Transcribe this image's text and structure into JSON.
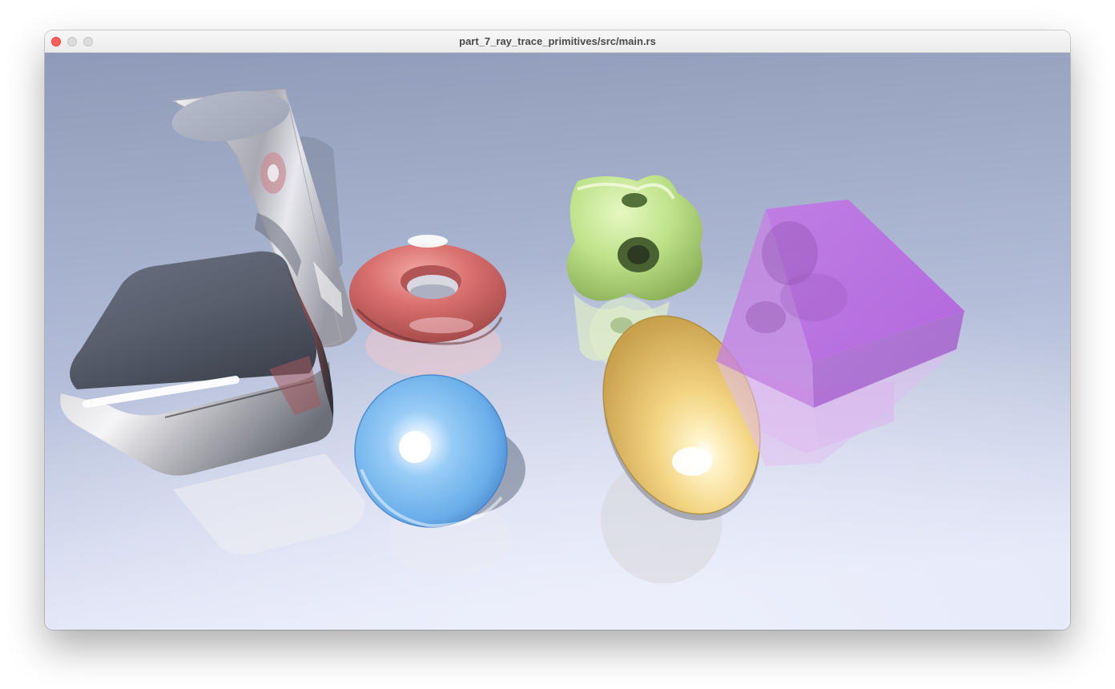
{
  "window": {
    "title": "part_7_ray_trace_primitives/src/main.rs",
    "controls": {
      "close": "close-button",
      "minimize": "minimize-button",
      "zoom": "zoom-button"
    }
  },
  "scene": {
    "background": {
      "top": "#8f9bb8",
      "bottom": "#e6eaf8"
    },
    "objects": [
      {
        "name": "mirror-cylinder",
        "material": "chrome",
        "color": "#c9c9cf"
      },
      {
        "name": "rounded-cube",
        "material": "chrome",
        "color": "#8a8f99"
      },
      {
        "name": "torus",
        "material": "glossy",
        "color": "#d9706f"
      },
      {
        "name": "sphere",
        "material": "glass",
        "color": "#7fbaf0"
      },
      {
        "name": "rounded-box-frame",
        "material": "glossy",
        "color": "#c3e68e"
      },
      {
        "name": "ellipsoid",
        "material": "glossy",
        "color": "#f2d27a"
      },
      {
        "name": "transparent-box",
        "material": "translucent",
        "color": "#c77ae8"
      }
    ]
  }
}
